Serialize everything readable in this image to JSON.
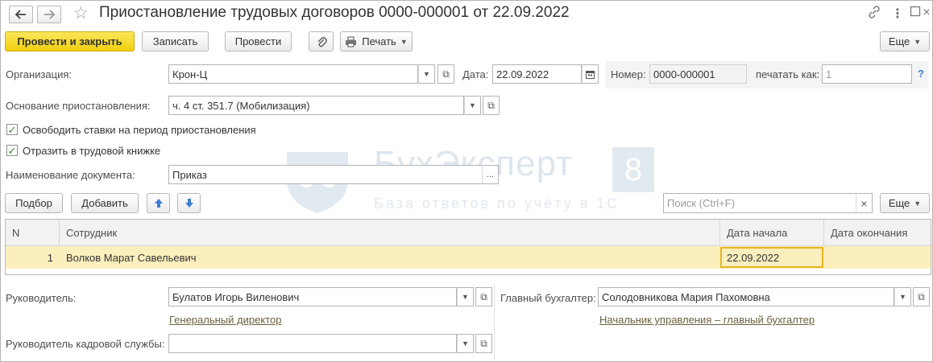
{
  "window": {
    "title": "Приостановление трудовых договоров 0000-000001 от 22.09.2022",
    "icons": [
      "back-arrow-icon",
      "forward-arrow-icon",
      "star-icon",
      "link-icon",
      "more-vertical-icon",
      "restore-icon",
      "close-icon"
    ]
  },
  "toolbar": {
    "post_and_close": "Провести и закрыть",
    "save": "Записать",
    "post": "Провести",
    "print": "Печать",
    "more": "Еще"
  },
  "form": {
    "org_label": "Организация:",
    "org_value": "Крон-Ц",
    "date_label": "Дата:",
    "date_value": "22.09.2022",
    "number_label": "Номер:",
    "number_value": "0000-000001",
    "print_as_label": "печатать как:",
    "print_as_placeholder": "1",
    "help": "?",
    "basis_label": "Основание приостановления:",
    "basis_value": "ч. 4 ст. 351.7 (Мобилизация)",
    "free_rates_label": "Освободить ставки на период приостановления",
    "free_rates_checked": true,
    "reflect_workbook_label": "Отразить в трудовой книжке",
    "reflect_workbook_checked": true,
    "doc_name_label": "Наименование документа:",
    "doc_name_value": "Приказ",
    "select_ellipsis": "..."
  },
  "table_toolbar": {
    "pick": "Подбор",
    "add": "Добавить",
    "search_placeholder": "Поиск (Ctrl+F)",
    "clear": "×",
    "more": "Еще"
  },
  "table": {
    "columns": [
      "N",
      "Сотрудник",
      "Дата начала",
      "Дата окончания"
    ],
    "rows": [
      {
        "n": "1",
        "employee": "Волков Марат Савельевич",
        "start": "22.09.2022",
        "end": ""
      }
    ]
  },
  "signers": {
    "head_label": "Руководитель:",
    "head_value": "Булатов Игорь Виленович",
    "head_position": "Генеральный директор",
    "accountant_label": "Главный бухгалтер:",
    "accountant_value": "Солодовникова Мария Пахомовна",
    "accountant_position": "Начальник управления – главный бухгалтер",
    "hr_head_label": "Руководитель кадровой службы:",
    "hr_head_value": ""
  },
  "watermark": {
    "brand": "БухЭксперт",
    "eight": "8",
    "tagline": "База ответов по учёту в 1С"
  },
  "colors": {
    "primary_button": "#f1cf0f",
    "selected_row": "#fbefbd",
    "active_cell_border": "#e8b51d",
    "checkbox_mark": "#3a8a2e",
    "arrow_button": "#3b7dd8"
  }
}
